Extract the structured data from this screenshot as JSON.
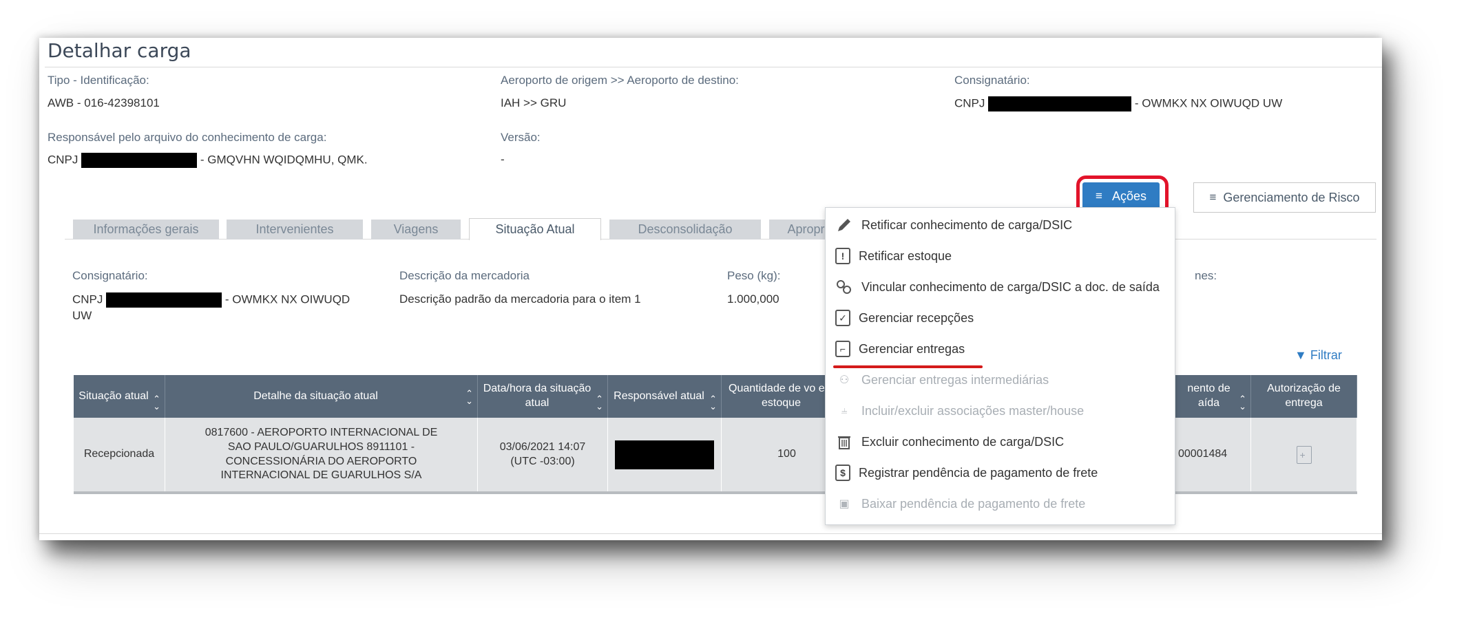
{
  "page": {
    "title": "Detalhar carga"
  },
  "header_info": {
    "tipo_label": "Tipo - Identificação:",
    "tipo_value": "AWB - 016-42398101",
    "aeroporto_label": "Aeroporto de origem >> Aeroporto de destino:",
    "aeroporto_value": "IAH >> GRU",
    "consignatario_label": "Consignatário:",
    "consignatario_prefix": "CNPJ",
    "consignatario_suffix": "- OWMKX NX OIWUQD UW",
    "responsavel_label": "Responsável pelo arquivo do conhecimento de carga:",
    "responsavel_prefix": "CNPJ",
    "responsavel_suffix": "- GMQVHN WQIDQMHU, QMK.",
    "versao_label": "Versão:",
    "versao_value": "-"
  },
  "buttons": {
    "acoes": "Ações",
    "gerenciamento_risco": "Gerenciamento de Risco",
    "filtrar": "Filtrar"
  },
  "tabs": [
    {
      "label": "Informações gerais",
      "active": false
    },
    {
      "label": "Intervenientes",
      "active": false
    },
    {
      "label": "Viagens",
      "active": false
    },
    {
      "label": "Situação Atual",
      "active": true
    },
    {
      "label": "Desconsolidação",
      "active": false
    },
    {
      "label": "Apropriação",
      "active": false
    }
  ],
  "detail": {
    "consignatario_label": "Consignatário:",
    "consignatario_prefix": "CNPJ",
    "consignatario_suffix": "- OWMKX NX OIWUQD",
    "consignatario_line2": "UW",
    "descricao_label": "Descrição da mercadoria",
    "descricao_value": "Descrição padrão da mercadoria para o item 1",
    "peso_label": "Peso (kg):",
    "peso_value": "1.000,000",
    "obs_label_partial": "nes:"
  },
  "table": {
    "headers": [
      "Situação atual",
      "Detalhe da situação atual",
      "Data/hora da situação atual",
      "Responsável atual",
      "Quantidade de vo em estoque",
      "nento de aída",
      "Autorização de entrega"
    ],
    "rows": [
      {
        "situacao": "Recepcionada",
        "detalhe": "0817600 - AEROPORTO INTERNACIONAL DE SAO PAULO/GUARULHOS 8911101 - CONCESSIONÁRIA DO AEROPORTO INTERNACIONAL DE GUARULHOS S/A",
        "data_hora": "03/06/2021 14:07 (UTC -03:00)",
        "quantidade": "100",
        "documento_saida": "00001484"
      }
    ]
  },
  "menu": {
    "items": [
      {
        "label": "Retificar conhecimento de carga/DSIC",
        "icon": "pencil-icon",
        "enabled": true
      },
      {
        "label": "Retificar estoque",
        "icon": "exclamation-box-icon",
        "enabled": true
      },
      {
        "label": "Vincular conhecimento de carga/DSIC a doc. de saída",
        "icon": "link-icon",
        "enabled": true
      },
      {
        "label": "Gerenciar recepções",
        "icon": "check-document-icon",
        "enabled": true
      },
      {
        "label": "Gerenciar entregas",
        "icon": "clipboard-icon",
        "enabled": true
      },
      {
        "label": "Gerenciar entregas intermediárias",
        "icon": "delivery-people-icon",
        "enabled": false
      },
      {
        "label": "Incluir/excluir associações master/house",
        "icon": "hierarchy-icon",
        "enabled": false
      },
      {
        "label": "Excluir conhecimento de carga/DSIC",
        "icon": "trash-icon",
        "enabled": true
      },
      {
        "label": "Registrar pendência de pagamento de frete",
        "icon": "dollar-document-icon",
        "enabled": true
      },
      {
        "label": "Baixar pendência de pagamento de frete",
        "icon": "money-icon",
        "enabled": false
      }
    ]
  },
  "colors": {
    "primary": "#2f7cc3",
    "table_header": "#586879",
    "highlight_red": "#e2132a",
    "tab_inactive": "#d4d7db"
  }
}
